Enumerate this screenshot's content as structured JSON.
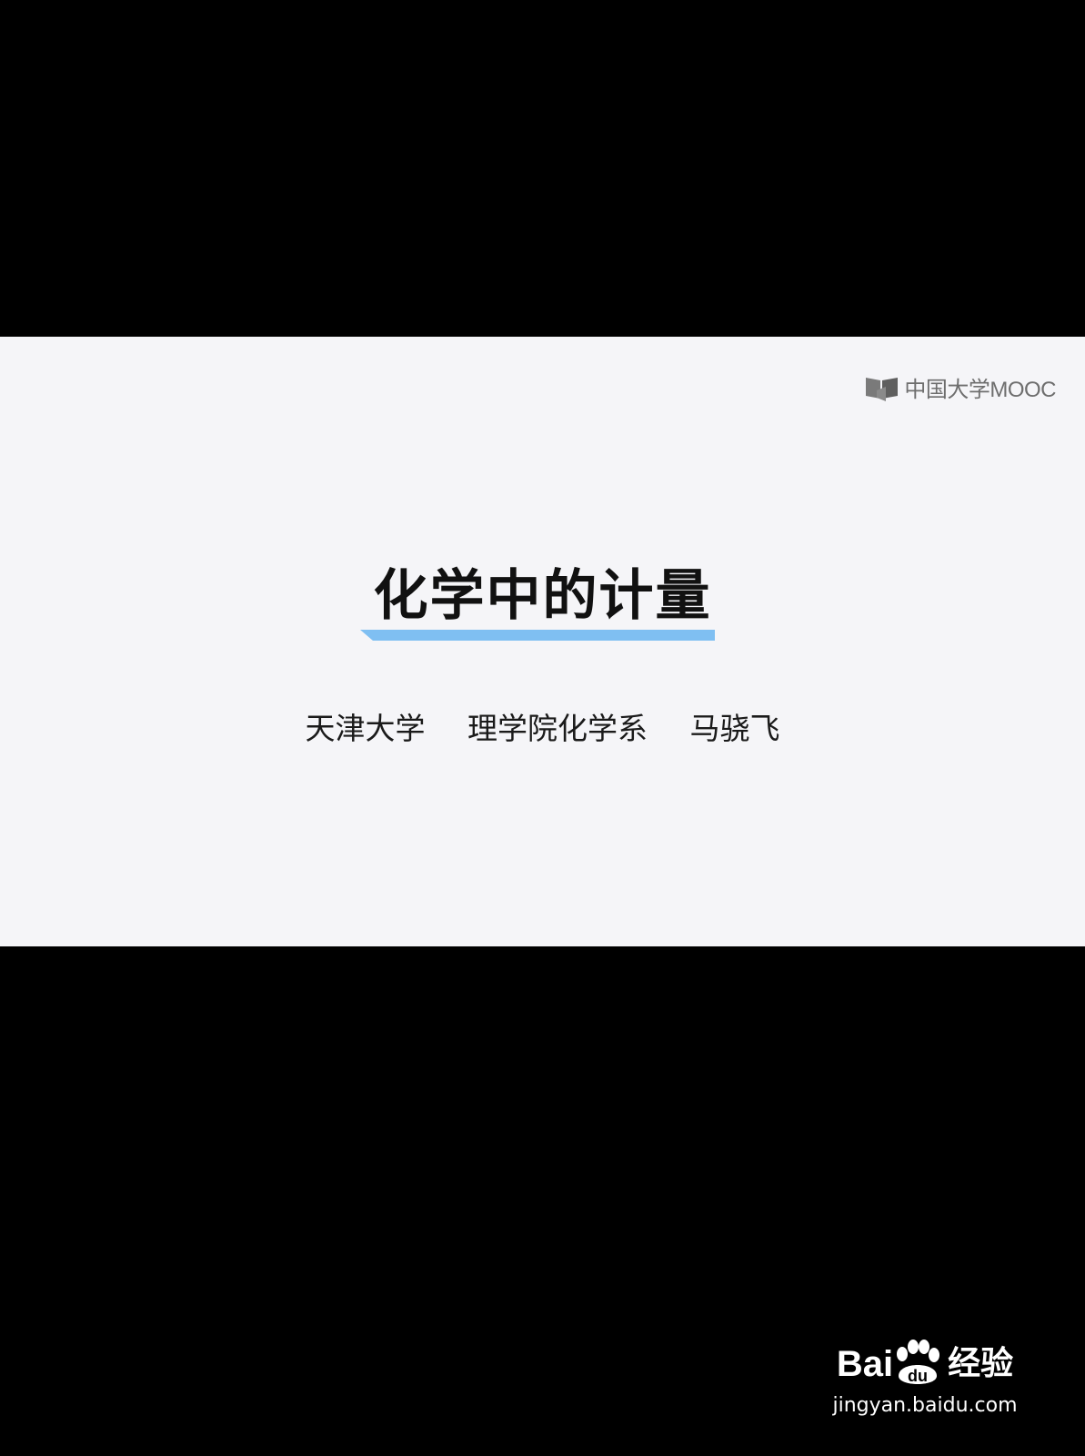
{
  "slide": {
    "logo_text": "中国大学MOOC",
    "title": "化学中的计量",
    "subtitle_parts": [
      "天津大学",
      "理学院化学系",
      "马骁飞"
    ]
  },
  "watermark": {
    "brand_left": "Bai",
    "brand_paw_text": "du",
    "brand_right": "经验",
    "url": "jingyan.baidu.com"
  },
  "colors": {
    "letterbox": "#000000",
    "slide_background": "#f5f5f8",
    "underline_accent": "#7fbff2",
    "title_text": "#111111"
  },
  "icons": [
    "mooc-book-icon",
    "baidu-paw-icon"
  ]
}
